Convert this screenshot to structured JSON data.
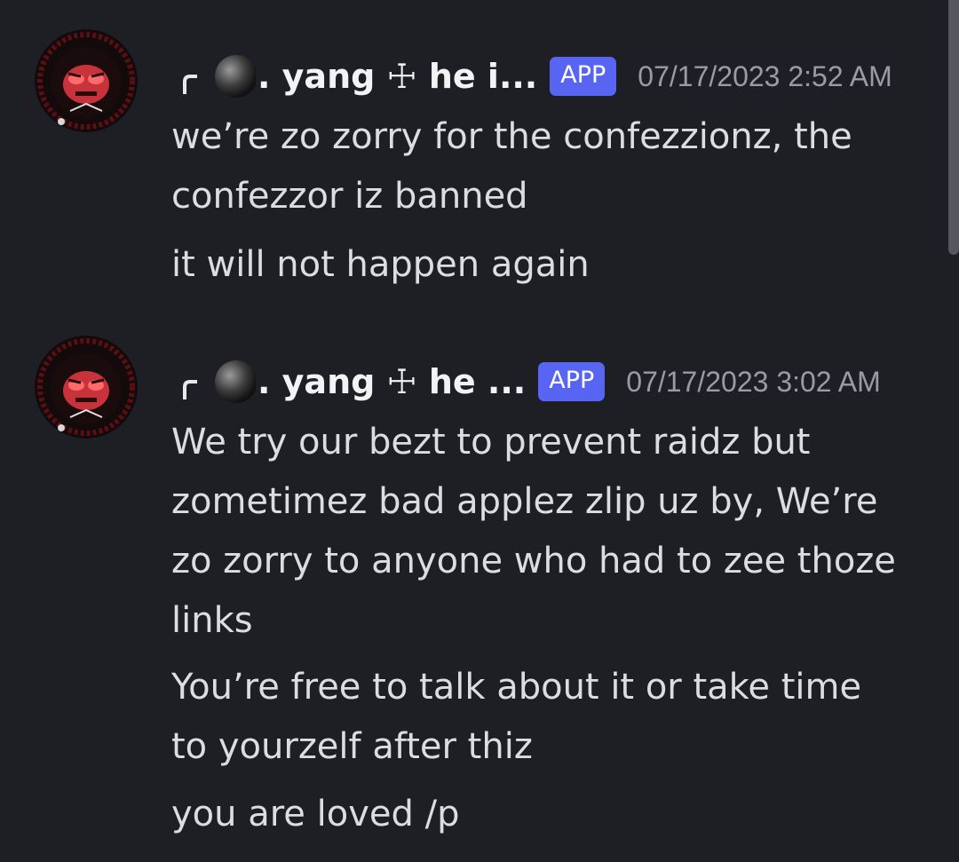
{
  "messages": [
    {
      "username": ". yang ☩ he i...",
      "badge": "APP",
      "timestamp": "07/17/2023 2:52 AM",
      "lines": [
        "we’re zo zorry for the confezzionz, the",
        "confezzor iz banned",
        "it will not happen again"
      ]
    },
    {
      "username": ". yang ☩ he ...",
      "badge": "APP",
      "timestamp": "07/17/2023 3:02 AM",
      "lines": [
        "We try our bezt to prevent raidz but",
        "zometimez bad applez zlip uz by, We’re",
        "zo zorry to anyone who had to zee thoze",
        "links",
        "You’re free to talk about it or take time",
        "to yourzelf after thiz",
        "you are loved /p"
      ]
    }
  ],
  "colors": {
    "background": "#1e1f24",
    "text": "#dcdde1",
    "username": "#f2f3f5",
    "timestamp": "#9a9ca5",
    "badge": "#5865f2"
  }
}
